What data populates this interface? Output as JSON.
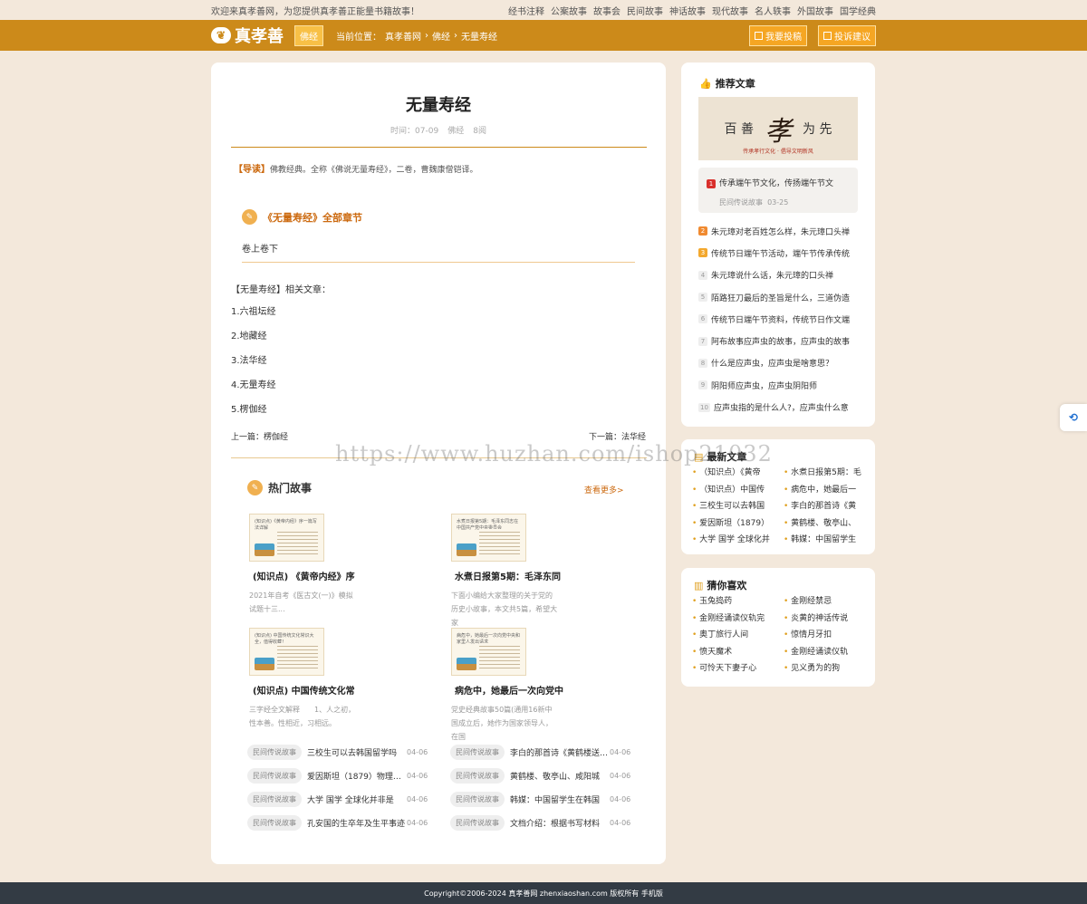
{
  "topbar": {
    "welcome": "欢迎来真孝善网，为您提供真孝善正能量书籍故事！",
    "links": [
      "经书注释",
      "公案故事",
      "故事会",
      "民间故事",
      "神话故事",
      "现代故事",
      "名人轶事",
      "外国故事",
      "国学经典"
    ]
  },
  "nav": {
    "logo": "真孝善",
    "category_badge": "佛经",
    "breadcrumb_prefix": "当前位置：",
    "breadcrumb": [
      "真孝善网",
      "佛经",
      "无量寿经"
    ],
    "submit_btn": "我要投稿",
    "complaint_btn": "投诉建议"
  },
  "article": {
    "title": "无量寿经",
    "time": "时间：07-09",
    "category": "佛经",
    "views": "8阅",
    "intro_tag": "【导读】",
    "intro_text": "佛教经典。全称《佛说无量寿经》，二卷，曹魏康僧铠译。",
    "chapters_title": "《无量寿经》全部章节",
    "chapters": [
      "卷上",
      "卷下"
    ],
    "related_head": "【无量寿经】相关文章：",
    "related": [
      "1.六祖坛经",
      "2.地藏经",
      "3.法华经",
      "4.无量寿经",
      "5.楞伽经"
    ],
    "prev": "上一篇：楞伽经",
    "next": "下一篇：法华经"
  },
  "hot": {
    "title": "热门故事",
    "more": "查看更多>",
    "cards": [
      {
        "thumb": "(知识点)《黄帝内经》序一篇写法详解",
        "title": "(知识点) 《黄帝内经》序",
        "desc": "2021年自考《医古文(一)》模拟试题十三..."
      },
      {
        "thumb": "水煮日报第5期：毛泽东同志在中国共产党中央委员会",
        "title": "水煮日报第5期：毛泽东同",
        "desc": "下面小编给大家整理的关于党的历史小故事，本文共5篇，希望大家"
      },
      {
        "thumb": "(知识点) 中国传统文化常识大全，值得收藏！",
        "title": "(知识点) 中国传统文化常",
        "desc": "三字经全文解释　　1、人之初，性本善。性相近，习相远。"
      },
      {
        "thumb": "病危中，她最后一次向党中央和家里人发出请求",
        "title": "病危中，她最后一次向党中",
        "desc": "党史经典故事50篇(通用16新中国成立后，她作为国家领导人，在国"
      }
    ],
    "list": [
      {
        "tag": "民间传说故事",
        "title": "三校生可以去韩国留学吗",
        "date": "04-06"
      },
      {
        "tag": "民间传说故事",
        "title": "李白的那首诗《黄鹤楼送孟浩然》",
        "date": "04-06"
      },
      {
        "tag": "民间传说故事",
        "title": "爱因斯坦（1879）物理学家",
        "date": "04-06"
      },
      {
        "tag": "民间传说故事",
        "title": "黄鹤楼、敬亭山、咸阳城",
        "date": "04-06"
      },
      {
        "tag": "民间传说故事",
        "title": "大学 国学 全球化并非是",
        "date": "04-06"
      },
      {
        "tag": "民间传说故事",
        "title": "韩媒：中国留学生在韩国",
        "date": "04-06"
      },
      {
        "tag": "民间传说故事",
        "title": "孔安国的生卒年及生平事迹",
        "date": "04-06"
      },
      {
        "tag": "民间传说故事",
        "title": "文档介绍：根据书写材料",
        "date": "04-06"
      }
    ]
  },
  "recommend": {
    "title": "推荐文章",
    "banner_left": "百 善",
    "banner_big": "孝",
    "banner_right": "为 先",
    "banner_sub": "传承孝行文化 · 倡导文明新风",
    "featured": {
      "title": "传承端午节文化，传扬端午节文",
      "source": "民间传说故事",
      "date": "03-25"
    },
    "items": [
      "朱元璋对老百姓怎么样，朱元璋口头禅",
      "传统节日端午节活动，端午节传承传统",
      "朱元璋说什么话，朱元璋的口头禅",
      "陌路狂刀最后的圣旨是什么，三道伪造",
      "传统节日端午节资料，传统节日作文端",
      "阿布故事应声虫的故事，应声虫的故事",
      "什么是应声虫，应声虫是啥意思？",
      "阴阳师应声虫，应声虫阴阳师",
      "应声虫指的是什么人?，应声虫什么意"
    ]
  },
  "latest": {
    "title": "最新文章",
    "items": [
      "（知识点）《黄帝",
      "水煮日报第5期：毛",
      "（知识点）中国传",
      "病危中，她最后一",
      "三校生可以去韩国",
      "李白的那首诗《黄",
      "爱因斯坦（1879）",
      "黄鹤楼、敬亭山、",
      "大学 国学 全球化并",
      "韩媒：中国留学生"
    ]
  },
  "guess": {
    "title": "猜你喜欢",
    "items": [
      "玉兔捣药",
      "金刚经禁忌",
      "金刚经诵读仪轨完",
      "炎黄的神话传说",
      "奥丁旅行人间",
      "惊情月牙扣",
      "愤天魔术",
      "金刚经诵读仪轨",
      "可怜天下妻子心",
      "见义勇为的狗"
    ]
  },
  "watermark": "https://www.huzhan.com/ishop21032",
  "footer": "Copyright©2006-2024 真孝善网 zhenxiaoshan.com 版权所有 手机版",
  "colors": {
    "accent": "#cc8a1a",
    "background": "#f3e8db",
    "footer": "#333b44"
  }
}
